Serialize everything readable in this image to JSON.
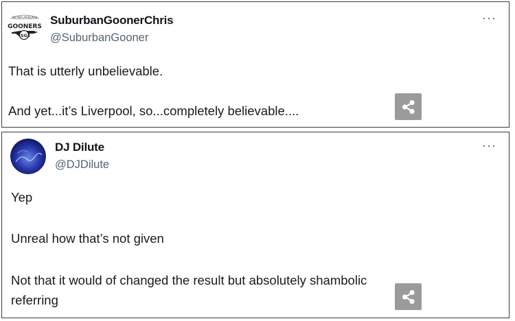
{
  "tweets": [
    {
      "display_name": "SuburbanGoonerChris",
      "handle": "@SuburbanGooner",
      "avatar_text_top": "SUBURBAN",
      "avatar_text_main": "GOONERS",
      "avatar_text_badge": "SG",
      "more_label": "···",
      "lines": [
        "That is utterly unbelievable.",
        "And yet...it’s Liverpool, so...completely believable...."
      ]
    },
    {
      "display_name": "DJ Dilute",
      "handle": "@DJDilute",
      "more_label": "···",
      "lines": [
        "Yep",
        "Unreal how that’s not given",
        "Not that it would of changed the result but absolutely shambolic",
        "referring"
      ]
    }
  ],
  "colors": {
    "name": "#0f1419",
    "handle": "#536471",
    "share_bg": "#9b9b9b",
    "border": "#3a3a3a"
  },
  "icons": {
    "share": "share-icon",
    "more": "more-dots-icon"
  }
}
